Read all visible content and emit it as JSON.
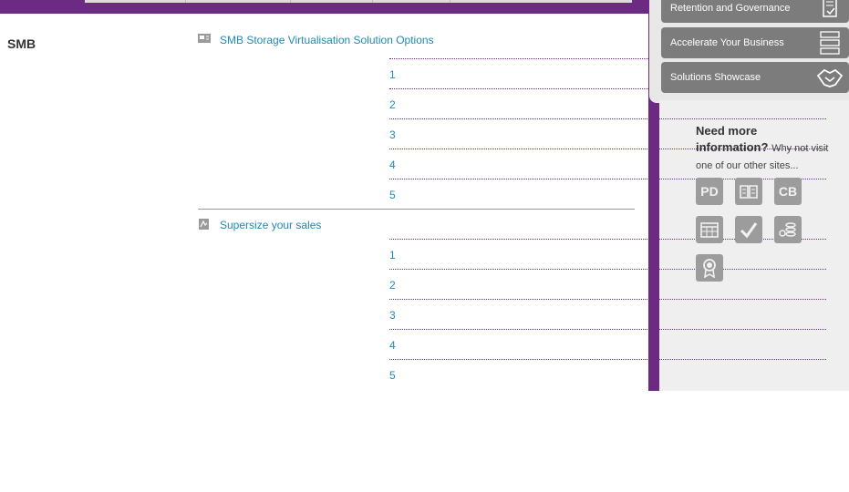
{
  "header": {
    "side_buttons": [
      {
        "label": "Retention and Governance",
        "icon": "document-check-icon"
      },
      {
        "label": "Accelerate Your Business",
        "icon": "server-rack-icon"
      },
      {
        "label": "Solutions Showcase",
        "icon": "handshake-icon"
      }
    ]
  },
  "main": {
    "section_title": "SMB",
    "documents": [
      {
        "title": "SMB Storage Virtualisation Solution Options",
        "icon": "presentation-icon",
        "pages": [
          "1",
          "2",
          "3",
          "4",
          "5"
        ]
      },
      {
        "title": "Supersize your sales",
        "icon": "pdf-icon",
        "pages": [
          "1",
          "2",
          "3",
          "4",
          "5"
        ]
      }
    ]
  },
  "sidebar": {
    "heading": "Need more information?",
    "subtext": "Why not visit one of our other sites...",
    "sites": [
      {
        "label": "PD",
        "icon": "pd-site-icon"
      },
      {
        "label": "",
        "icon": "book-site-icon"
      },
      {
        "label": "CB",
        "icon": "cb-site-icon"
      },
      {
        "label": "",
        "icon": "calendar-site-icon"
      },
      {
        "label": "",
        "icon": "checkmark-site-icon"
      },
      {
        "label": "",
        "icon": "coins-site-icon"
      },
      {
        "label": "",
        "icon": "award-site-icon"
      }
    ]
  },
  "colors": {
    "accent_purple": "#6c2a82",
    "link_blue": "#1e8ab5",
    "button_gray": "#7c7c7c",
    "panel_gray": "#efefef"
  }
}
